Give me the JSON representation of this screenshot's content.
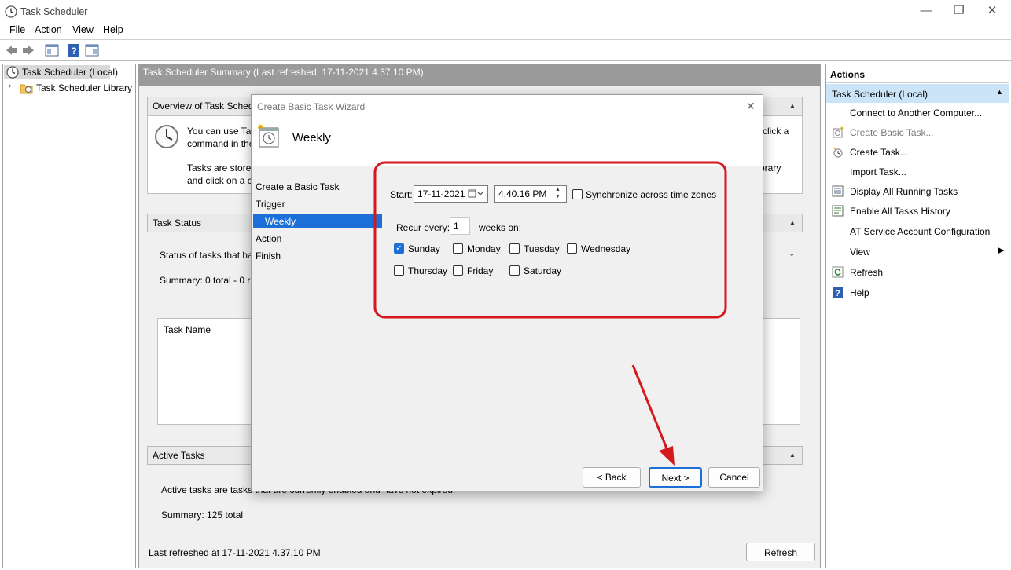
{
  "window": {
    "title": "Task Scheduler",
    "minimize": "—",
    "maximize": "❐",
    "close": "✕"
  },
  "menu": [
    "File",
    "Action",
    "View",
    "Help"
  ],
  "tree": {
    "root": "Task Scheduler (Local)",
    "library": "Task Scheduler Library"
  },
  "center": {
    "header": "Task Scheduler Summary (Last refreshed: 17-11-2021 4.37.10 PM)",
    "overview": {
      "title": "Overview of Task Schedul",
      "line1": "You can use Task",
      "line1_right": "click a",
      "line2": "command in the",
      "line3": "Tasks are stored i",
      "line3_right": "brary",
      "line4": "and click on a co"
    },
    "task_status": {
      "title": "Task Status",
      "status_text": "Status of tasks that have",
      "summary": "Summary: 0 total - 0 ru",
      "col_task_name": "Task Name"
    },
    "active_tasks": {
      "title": "Active Tasks",
      "desc": "Active tasks are tasks that are currently enabled and have not expired.",
      "summary": "Summary: 125 total"
    },
    "last_refreshed": "Last refreshed at 17-11-2021 4.37.10 PM",
    "refresh_button": "Refresh"
  },
  "actions": {
    "header": "Actions",
    "group": "Task Scheduler (Local)",
    "items": [
      {
        "label": "Connect to Another Computer...",
        "icon": "none",
        "disabled": false
      },
      {
        "label": "Create Basic Task...",
        "icon": "wizard-icon",
        "disabled": true
      },
      {
        "label": "Create Task...",
        "icon": "task-icon",
        "disabled": false
      },
      {
        "label": "Import Task...",
        "icon": "none",
        "disabled": false
      },
      {
        "label": "Display All Running Tasks",
        "icon": "list-icon",
        "disabled": false
      },
      {
        "label": "Enable All Tasks History",
        "icon": "history-icon",
        "disabled": false
      },
      {
        "label": "AT Service Account Configuration",
        "icon": "none",
        "disabled": false
      },
      {
        "label": "View",
        "icon": "none",
        "disabled": false
      },
      {
        "label": "Refresh",
        "icon": "refresh-icon",
        "disabled": false
      },
      {
        "label": "Help",
        "icon": "help-icon",
        "disabled": false
      }
    ]
  },
  "dialog": {
    "title": "Create Basic Task Wizard",
    "heading": "Weekly",
    "close": "✕",
    "nav": [
      "Create a Basic Task",
      "Trigger",
      "Weekly",
      "Action",
      "Finish"
    ],
    "start_label": "Start:",
    "start_date": "17-11-2021",
    "start_time": "4.40.16 PM",
    "sync_label": "Synchronize across time zones",
    "recur_label": "Recur every:",
    "recur_value": "1",
    "weeks_on": "weeks on:",
    "days": [
      {
        "label": "Sunday",
        "checked": true
      },
      {
        "label": "Monday",
        "checked": false
      },
      {
        "label": "Tuesday",
        "checked": false
      },
      {
        "label": "Wednesday",
        "checked": false
      },
      {
        "label": "Thursday",
        "checked": false
      },
      {
        "label": "Friday",
        "checked": false
      },
      {
        "label": "Saturday",
        "checked": false
      }
    ],
    "back": "< Back",
    "next": "Next >",
    "cancel": "Cancel"
  },
  "colors": {
    "accent": "#1c6fd6",
    "annotation": "#d4191c",
    "selection": "#cce4f7"
  }
}
